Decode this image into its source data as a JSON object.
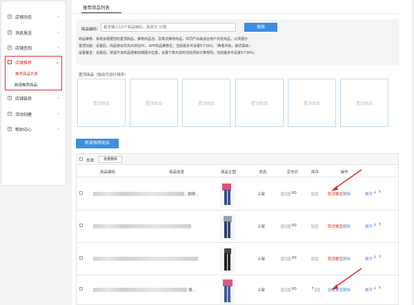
{
  "sidebar": {
    "items": [
      {
        "label": "店铺动态"
      },
      {
        "label": "消息发送"
      },
      {
        "label": "店铺签到"
      },
      {
        "label": "店铺推荐"
      },
      {
        "label": "店铺装修"
      },
      {
        "label": "活动创建"
      },
      {
        "label": "帮助中心"
      }
    ],
    "sub_items": [
      {
        "label": "推荐商品列表"
      },
      {
        "label": "新增推荐商品"
      }
    ]
  },
  "tab": {
    "label": "推荐商品列表"
  },
  "filter": {
    "label": "商品编码：",
    "placeholder": "最多输入10个商品编码，用英文,分隔",
    "search_label": "搜索",
    "desc": [
      "商品推荐：系统会根据您的置顶商品、推荐商品池，及算法推荐商品，共同产出最适合用户浏览商品，以供展示",
      "置顶功能：设置后，商品将会优先出现在PC、APP商品推荐位；当前最多可设置5个SKU。（两者共轨，最优属轨）",
      "设置餐宣：设置后，将提升该商品搜索前端展示位置，设置个数为您的当前项目计算规则，当前最多可设置5个SPU。"
    ]
  },
  "pinned": {
    "label": "置顶商品（拖动可进行排序）",
    "slots": [
      "置顶商品",
      "置顶商品",
      "置顶商品",
      "置顶商品",
      "置顶商品",
      "置顶商品"
    ]
  },
  "add_button": "新增推荐商品",
  "table": {
    "select_all": "全选",
    "bulk_delete": "批量删除",
    "headers": [
      "商品编码",
      "商品信息",
      "商品主图",
      "状态",
      "京东价",
      "库存",
      "操作"
    ],
    "rows": [
      {
        "info_suffix": "...钢哥...",
        "status": "上架",
        "price": ".00",
        "stock": "",
        "action": "取消餐宣",
        "action_color": "red",
        "delete": "删除",
        "expand": "展开"
      },
      {
        "info_suffix": "",
        "status": "上架",
        "price": ".00",
        "stock": "",
        "action": "取消餐宣",
        "action_color": "red",
        "delete": "删除",
        "expand": "展开"
      },
      {
        "info_suffix": "",
        "status": "上架",
        "price": ".00",
        "stock": "",
        "action": "取消餐宣",
        "action_color": "red",
        "delete": "删除",
        "expand": "展开"
      },
      {
        "info_suffix": "裤...",
        "status": "上架",
        "price": ".00",
        "stock": "7",
        "action": "设置餐宣",
        "action_color": "blue",
        "delete": "删除",
        "expand": "展开"
      }
    ]
  },
  "colors": {
    "accent": "#3d8ee0",
    "alert": "#d9312b"
  }
}
